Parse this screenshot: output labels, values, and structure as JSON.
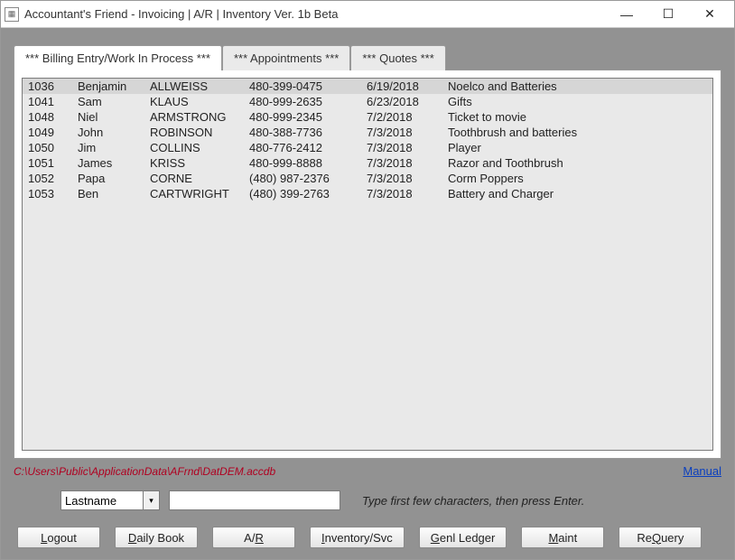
{
  "window": {
    "title": "Accountant's Friend - Invoicing | A/R | Inventory Ver. 1b Beta"
  },
  "tabs": {
    "billing": "*** Billing Entry/Work In Process ***",
    "appointments": "*** Appointments ***",
    "quotes": "*** Quotes ***"
  },
  "grid": {
    "rows": [
      {
        "id": "1036",
        "first": "Benjamin",
        "last": "ALLWEISS",
        "phone": "480-399-0475",
        "date": "6/19/2018",
        "desc": "Noelco and Batteries"
      },
      {
        "id": "1041",
        "first": "Sam",
        "last": "KLAUS",
        "phone": "480-999-2635",
        "date": "6/23/2018",
        "desc": "Gifts"
      },
      {
        "id": "1048",
        "first": "Niel",
        "last": "ARMSTRONG",
        "phone": "480-999-2345",
        "date": "7/2/2018",
        "desc": "Ticket to movie"
      },
      {
        "id": "1049",
        "first": "John",
        "last": "ROBINSON",
        "phone": "480-388-7736",
        "date": "7/3/2018",
        "desc": "Toothbrush and batteries"
      },
      {
        "id": "1050",
        "first": "Jim",
        "last": "COLLINS",
        "phone": "480-776-2412",
        "date": "7/3/2018",
        "desc": "Player"
      },
      {
        "id": "1051",
        "first": "James",
        "last": "KRISS",
        "phone": "480-999-8888",
        "date": "7/3/2018",
        "desc": "Razor and Toothbrush"
      },
      {
        "id": "1052",
        "first": "Papa",
        "last": "CORNE",
        "phone": "(480) 987-2376",
        "date": "7/3/2018",
        "desc": "Corm Poppers"
      },
      {
        "id": "1053",
        "first": "Ben",
        "last": "CARTWRIGHT",
        "phone": "(480) 399-2763",
        "date": "7/3/2018",
        "desc": "Battery and Charger"
      }
    ]
  },
  "path": "C:\\Users\\Public\\ApplicationData\\AFrnd\\DatDEM.accdb",
  "manual_link": "Manual",
  "search": {
    "field": "Lastname",
    "value": "",
    "hint": "Type first few characters, then press Enter."
  },
  "buttons": {
    "logout": {
      "pre": "",
      "ul": "L",
      "post": "ogout"
    },
    "daily": {
      "pre": "",
      "ul": "D",
      "post": "aily Book"
    },
    "ar": {
      "pre": "A/",
      "ul": "R",
      "post": ""
    },
    "inv": {
      "pre": "",
      "ul": "I",
      "post": "nventory/Svc"
    },
    "genl": {
      "pre": "",
      "ul": "G",
      "post": "enl Ledger"
    },
    "maint": {
      "pre": "",
      "ul": "M",
      "post": "aint"
    },
    "requery": {
      "pre": "Re",
      "ul": "Q",
      "post": "uery"
    }
  }
}
